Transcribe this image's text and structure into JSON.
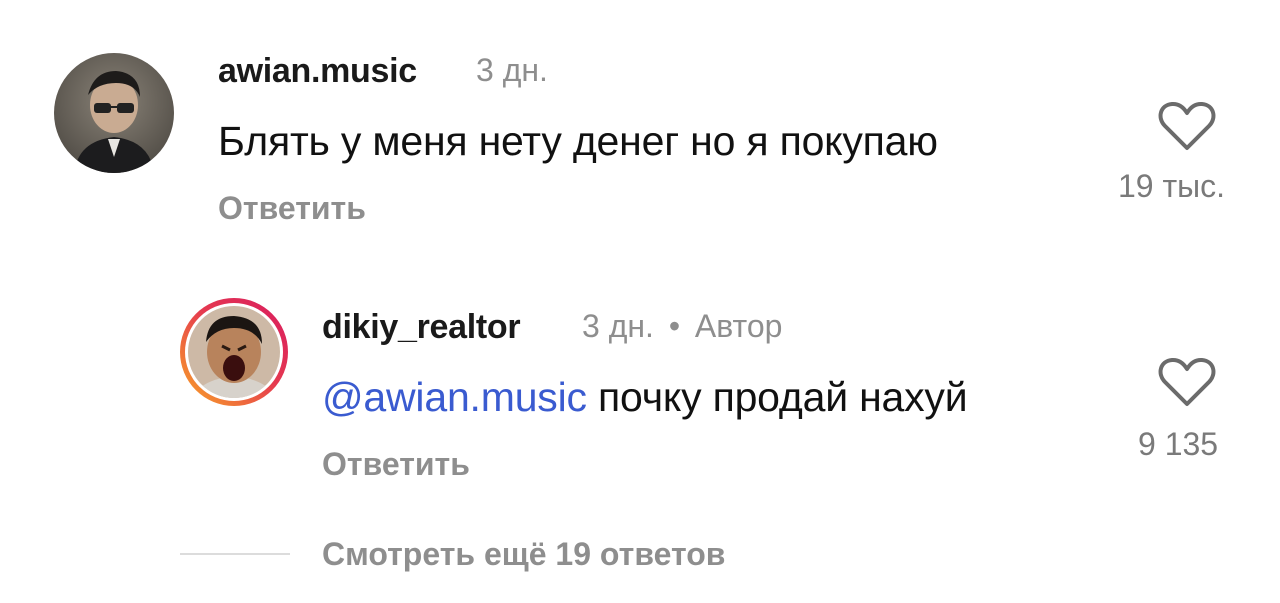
{
  "comments": [
    {
      "username": "awian.music",
      "time": "3 дн.",
      "text": "Блять у меня нету денег но я покупаю",
      "reply_label": "Ответить",
      "like_count": "19 тыс."
    },
    {
      "username": "dikiy_realtor",
      "time": "3 дн.",
      "separator": "•",
      "author_badge": "Автор",
      "mention": "@awian.music",
      "text": "почку продай нахуй",
      "reply_label": "Ответить",
      "like_count": "9 135"
    }
  ],
  "view_more_label": "Смотреть ещё 19 ответов",
  "colors": {
    "mention": "#3a5bd0",
    "muted": "#8e8e8e",
    "story_ring_start": "#f9a825",
    "story_ring_end": "#d81b60"
  },
  "icons": {
    "like": "heart-outline-icon"
  }
}
